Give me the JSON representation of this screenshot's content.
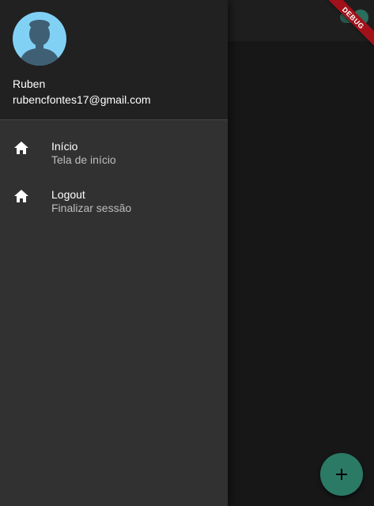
{
  "drawer": {
    "account": {
      "name": "Ruben",
      "email": "rubencfontes17@gmail.com"
    },
    "items": [
      {
        "icon": "home-icon",
        "title": "Início",
        "subtitle": "Tela de início"
      },
      {
        "icon": "home-icon",
        "title": "Logout",
        "subtitle": "Finalizar sessão"
      }
    ]
  },
  "debug_banner": {
    "label": "DEBUG"
  },
  "fab": {
    "icon": "plus-icon"
  },
  "colors": {
    "drawer_bg": "#313131",
    "header_bg": "#212121",
    "accent": "#2b7a66",
    "avatar_bg": "#81d1f5",
    "debug_banner": "#a1111a"
  }
}
